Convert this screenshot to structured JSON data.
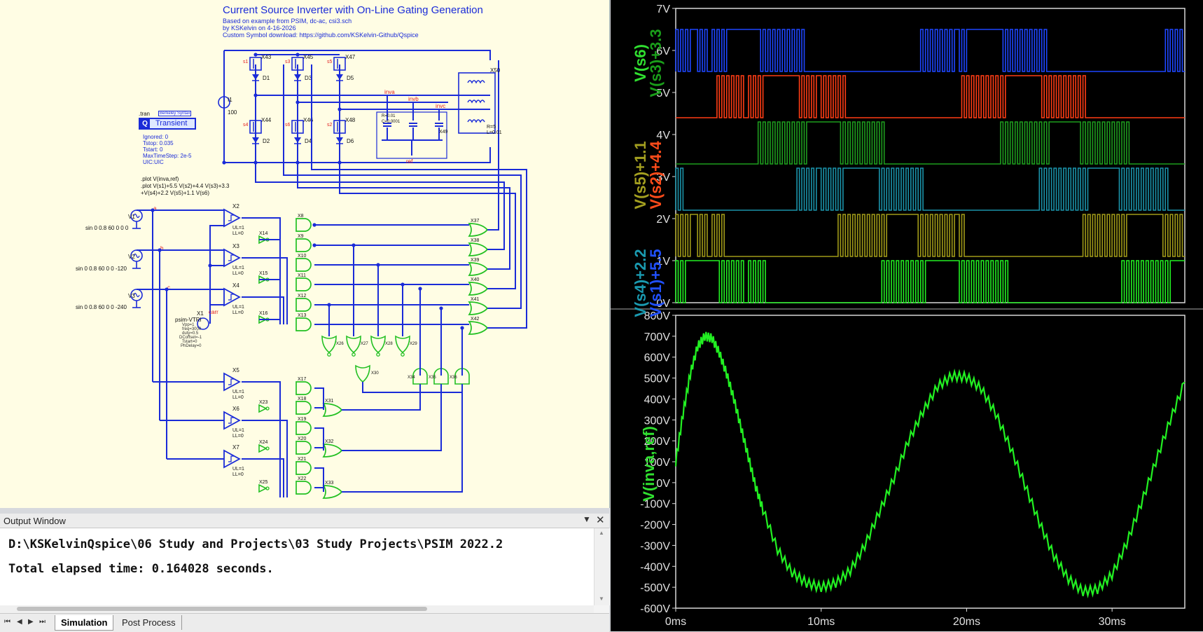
{
  "schematic": {
    "title": "Current Source Inverter with On-Line Gating Generation",
    "subtitle_lines": [
      "Based on example from PSIM, dc-ac, csi3.sch",
      "by KSKelvin on 4-16-2026",
      "Custom Symbol download: https://github.com/KSKelvin-Github/Qspice"
    ],
    "tran": {
      "label": ".tran",
      "badge": "Berkeley Syntax",
      "button": "Transient",
      "params": [
        "Ignored: 0",
        "Tstop: 0.035",
        "Tstart: 0",
        "MaxTimeStep: 2e-5",
        "UIC:UIC"
      ]
    },
    "plot_cmds": [
      ".plot V(inva,ref)",
      ".plot V(s1)+5.5 V(s2)+4.4 V(s3)+3.3",
      "+V(s4)+2.2 V(s5)+1.1 V(s6)"
    ],
    "sources": [
      {
        "name": "V1",
        "value": "sin 0 0.8 60 0 0 0"
      },
      {
        "name": "V2",
        "value": "sin 0 0.8 60 0 0 -120"
      },
      {
        "name": "V3",
        "value": "sin 0 0.8 60 0 0 -240"
      }
    ],
    "current_source": {
      "name": "I1",
      "value": "100"
    },
    "carrier": {
      "name": "X1",
      "model": "psim-VTRI",
      "net": "carr",
      "params": [
        "Vpp=1",
        "freq=3000",
        "duty=0.5",
        "DCoffset=-1",
        "Tstart=0",
        "PhDelay=0"
      ]
    },
    "switches": [
      "X43",
      "X45",
      "X47",
      "X44",
      "X46",
      "X48"
    ],
    "switch_nets": [
      "s1",
      "s3",
      "s5",
      "s4",
      "s6",
      "s2"
    ],
    "diodes": [
      "D1",
      "D3",
      "D5",
      "D2",
      "D4",
      "D6"
    ],
    "nets": [
      "inva",
      "invb",
      "invc",
      "ref"
    ],
    "filter": {
      "label": "R=0.01\nC=0.0001",
      "rc": "R=5",
      "l": "L=0.01",
      "load": "X50",
      "cap": "X49"
    },
    "comparators_top": [
      {
        "name": "X2"
      },
      {
        "name": "X3"
      },
      {
        "name": "X4"
      }
    ],
    "comparators_bot": [
      {
        "name": "X5"
      },
      {
        "name": "X6"
      },
      {
        "name": "X7"
      }
    ],
    "ul_ll": [
      "UL=1",
      "LL=0"
    ],
    "inverters_top": [
      "X14",
      "X15",
      "X16"
    ],
    "inverters_bot": [
      "X23",
      "X24",
      "X25"
    ],
    "and_top": [
      "X8",
      "X9",
      "X10",
      "X11",
      "X12",
      "X13"
    ],
    "and_bot": [
      "X17",
      "X18",
      "X19",
      "X20",
      "X21",
      "X22"
    ],
    "or_right": [
      "X37",
      "X38",
      "X39",
      "X40",
      "X41",
      "X42"
    ],
    "or_bot": [
      "X31",
      "X32",
      "X33"
    ],
    "nor_mid": [
      "X26",
      "X27",
      "X28",
      "X29"
    ],
    "misc_gates": [
      "X30",
      "X34",
      "X35",
      "X36"
    ],
    "net_labels_abc": [
      "a",
      "b",
      "c"
    ]
  },
  "output_window": {
    "title": "Output Window",
    "menu_icon": "chevron-down-icon",
    "close_icon": "close-icon",
    "lines": [
      "D:\\KSKelvinQspice\\06 Study and Projects\\03 Study Projects\\PSIM 2022.2",
      "Total elapsed time: 0.164028 seconds."
    ],
    "tabs": [
      "Simulation",
      "Post Process"
    ],
    "active_tab": "Simulation"
  },
  "chart_data": [
    {
      "type": "line",
      "title": "",
      "ylim": [
        0,
        7
      ],
      "yticks": [
        "0V",
        "1V",
        "2V",
        "3V",
        "4V",
        "5V",
        "6V",
        "7V"
      ],
      "grid": false,
      "xlim_ms": [
        0,
        35
      ],
      "legend_placement": "left",
      "legend": [
        {
          "text": "V(s6)",
          "color": "#30e030"
        },
        {
          "text": "V(s3)+3.3",
          "color": "#1a9e1a"
        },
        {
          "text": "V(s5)+1.1",
          "color": "#a4a020"
        },
        {
          "text": "V(s2)+4.4",
          "color": "#ff4b1a"
        },
        {
          "text": "V(s4)+2.2",
          "color": "#1a9ab0"
        },
        {
          "text": "V(s1)+5.5",
          "color": "#2050ff"
        }
      ],
      "series": [
        {
          "name": "V(s1)+5.5",
          "color": "#1e46ff",
          "low": 5.5,
          "high": 6.5,
          "offset_ms": 0
        },
        {
          "name": "V(s2)+4.4",
          "color": "#ff3c14",
          "low": 4.4,
          "high": 5.4,
          "offset_ms": 2.78
        },
        {
          "name": "V(s3)+3.3",
          "color": "#1e9e1e",
          "low": 3.3,
          "high": 4.3,
          "offset_ms": 5.56
        },
        {
          "name": "V(s4)+2.2",
          "color": "#1a93aa",
          "low": 2.2,
          "high": 3.2,
          "offset_ms": 8.33
        },
        {
          "name": "V(s5)+1.1",
          "color": "#a09a18",
          "low": 1.1,
          "high": 2.1,
          "offset_ms": 11.11
        },
        {
          "name": "V(s6)",
          "color": "#22f022",
          "low": 0,
          "high": 1,
          "offset_ms": 13.89
        }
      ],
      "period_ms": 16.667
    },
    {
      "type": "line",
      "title": "",
      "ylim": [
        -600,
        800
      ],
      "yticks": [
        "-600V",
        "-500V",
        "-400V",
        "-300V",
        "-200V",
        "-100V",
        "0V",
        "100V",
        "200V",
        "300V",
        "400V",
        "500V",
        "600V",
        "700V",
        "800V"
      ],
      "xticks": [
        "0ms",
        "10ms",
        "20ms",
        "30ms"
      ],
      "xlim_ms": [
        0,
        35
      ],
      "grid": false,
      "legend": [
        {
          "text": "V(inva,ref)",
          "color": "#30e030"
        }
      ],
      "series": [
        {
          "name": "V(inva,ref)",
          "color": "#22f022",
          "x_ms": [
            0,
            0.5,
            1,
            1.5,
            2,
            2.5,
            3,
            3.5,
            4,
            4.5,
            5,
            5.5,
            6,
            7,
            8,
            9,
            10,
            11,
            12,
            13,
            14,
            15,
            16,
            17,
            18,
            19,
            20,
            21,
            22,
            23,
            24,
            25,
            26,
            27,
            28,
            29,
            30,
            31,
            32,
            33,
            34,
            35
          ],
          "y": [
            100,
            330,
            520,
            650,
            700,
            690,
            620,
            520,
            400,
            260,
            120,
            -20,
            -130,
            -320,
            -430,
            -480,
            -500,
            -480,
            -420,
            -300,
            -140,
            20,
            200,
            340,
            460,
            510,
            505,
            450,
            330,
            170,
            -10,
            -190,
            -350,
            -460,
            -520,
            -510,
            -440,
            -290,
            -100,
            100,
            300,
            480
          ]
        }
      ]
    }
  ]
}
